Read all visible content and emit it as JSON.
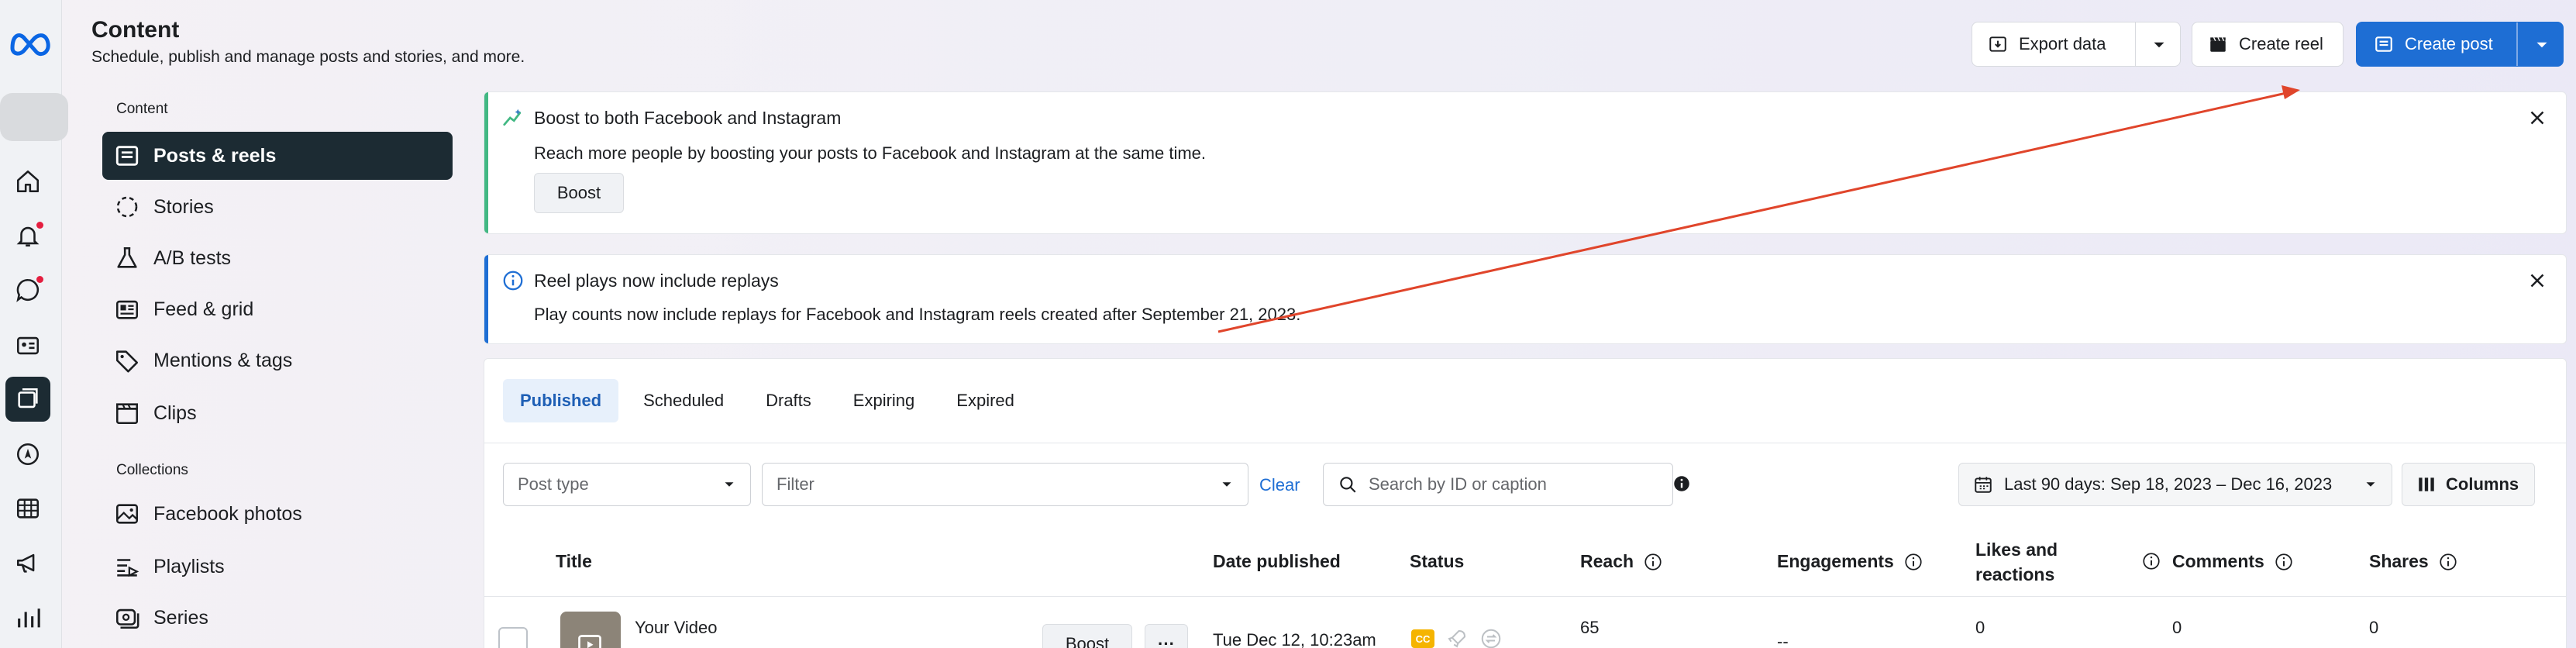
{
  "header": {
    "title": "Content",
    "subtitle": "Schedule, publish and manage posts and stories, and more."
  },
  "toolbar": {
    "export_label": "Export data",
    "create_reel_label": "Create reel",
    "create_post_label": "Create post"
  },
  "sidebar": {
    "section_content": "Content",
    "section_collections": "Collections",
    "items": [
      {
        "label": "Posts & reels",
        "icon": "posts-icon"
      },
      {
        "label": "Stories",
        "icon": "stories-icon"
      },
      {
        "label": "A/B tests",
        "icon": "flask-icon"
      },
      {
        "label": "Feed & grid",
        "icon": "feed-grid-icon"
      },
      {
        "label": "Mentions & tags",
        "icon": "tag-icon"
      },
      {
        "label": "Clips",
        "icon": "clapperboard-icon"
      }
    ],
    "collection_items": [
      {
        "label": "Facebook photos",
        "icon": "photo-icon"
      },
      {
        "label": "Playlists",
        "icon": "playlist-icon"
      },
      {
        "label": "Series",
        "icon": "series-icon"
      }
    ]
  },
  "notices": {
    "boost": {
      "title": "Boost to both Facebook and Instagram",
      "body": "Reach more people by boosting your posts to Facebook and Instagram at the same time.",
      "button": "Boost"
    },
    "replays": {
      "title": "Reel plays now include replays",
      "body": "Play counts now include replays for Facebook and Instagram reels created after September 21, 2023."
    }
  },
  "tabs": [
    "Published",
    "Scheduled",
    "Drafts",
    "Expiring",
    "Expired"
  ],
  "filters": {
    "post_type_placeholder": "Post type",
    "filter_placeholder": "Filter",
    "clear_label": "Clear",
    "search_placeholder": "Search by ID or caption",
    "date_range": "Last 90 days: Sep 18, 2023 – Dec 16, 2023",
    "columns_label": "Columns"
  },
  "table": {
    "headers": {
      "title": "Title",
      "date_published": "Date published",
      "status": "Status",
      "reach": "Reach",
      "engagements": "Engagements",
      "likes_line1": "Likes and",
      "likes_line2": "reactions",
      "comments": "Comments",
      "shares": "Shares"
    },
    "rows": [
      {
        "title": "Your Video",
        "boost": "Boost",
        "more": "···",
        "date": "Tue Dec 12, 10:23am",
        "cc": "CC",
        "reach": "65",
        "engagements": "--",
        "likes": "0",
        "comments": "0",
        "shares": "0"
      }
    ]
  },
  "colors": {
    "primary": "#1e6ed4",
    "nav_active": "#1c2b33",
    "boost_accent": "#42b883",
    "info_accent": "#1e6ed4",
    "annotation_arrow": "#e0452b"
  }
}
